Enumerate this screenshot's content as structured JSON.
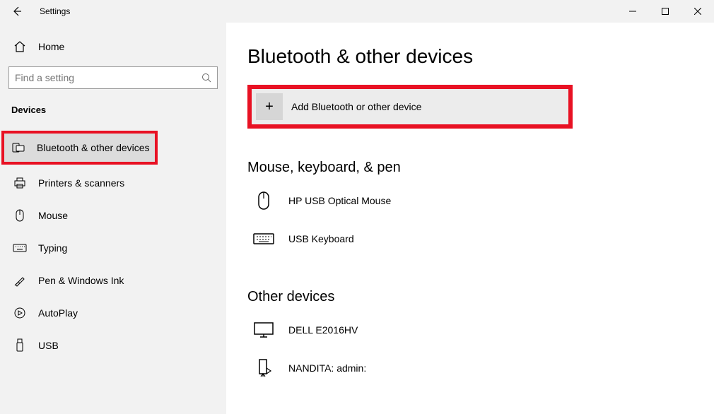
{
  "window": {
    "title": "Settings"
  },
  "sidebar": {
    "home_label": "Home",
    "search_placeholder": "Find a setting",
    "section_label": "Devices",
    "items": [
      {
        "label": "Bluetooth & other devices",
        "icon": "bluetooth-devices-icon",
        "active": true,
        "highlight": true
      },
      {
        "label": "Printers & scanners",
        "icon": "printer-icon"
      },
      {
        "label": "Mouse",
        "icon": "mouse-icon"
      },
      {
        "label": "Typing",
        "icon": "keyboard-icon"
      },
      {
        "label": "Pen & Windows Ink",
        "icon": "pen-icon"
      },
      {
        "label": "AutoPlay",
        "icon": "autoplay-icon"
      },
      {
        "label": "USB",
        "icon": "usb-icon"
      }
    ]
  },
  "content": {
    "page_title": "Bluetooth & other devices",
    "add_button_label": "Add Bluetooth or other device",
    "groups": [
      {
        "heading": "Mouse, keyboard, & pen",
        "devices": [
          {
            "label": "HP USB Optical Mouse",
            "icon": "mouse-device-icon"
          },
          {
            "label": "USB Keyboard",
            "icon": "keyboard-device-icon"
          }
        ]
      },
      {
        "heading": "Other devices",
        "devices": [
          {
            "label": "DELL E2016HV",
            "icon": "monitor-icon"
          },
          {
            "label": "NANDITA: admin:",
            "icon": "media-device-icon"
          }
        ]
      }
    ]
  },
  "highlights": {
    "sidebar_item": 0,
    "add_button": true
  }
}
